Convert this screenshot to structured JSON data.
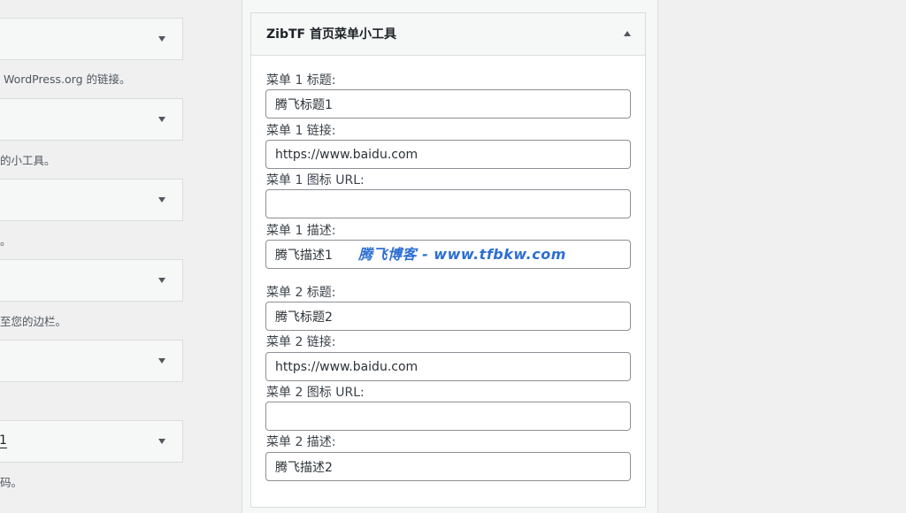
{
  "available_widgets": {
    "bars": [
      {
        "label": ""
      },
      {
        "label": ""
      },
      {
        "label": ""
      },
      {
        "label": ""
      },
      {
        "label": ""
      },
      {
        "label": "1"
      }
    ],
    "descriptions": [
      "WordPress.org 的链接。",
      "的小工具。",
      "。",
      "至您的边栏。",
      "码。"
    ]
  },
  "widget": {
    "title": "ZibTF 首页菜单小工具",
    "fields": [
      {
        "label": "菜单 1 标题:",
        "value": ""
      },
      {
        "label": "菜单 1 链接:",
        "value": "https://www.baidu.com"
      },
      {
        "label": "菜单 1 图标 URL:",
        "value": ""
      },
      {
        "label": "菜单 1 描述:",
        "value": "腾飞描述1"
      },
      {
        "label": "菜单 2 标题:",
        "value": "腾飞标题2"
      },
      {
        "label": "菜单 2 链接:",
        "value": "https://www.baidu.com"
      },
      {
        "label": "菜单 2 图标 URL:",
        "value": ""
      },
      {
        "label": "菜单 2 描述:",
        "value": "腾飞描述2"
      }
    ],
    "field0_value": "腾飞标题1"
  },
  "watermark": {
    "text": "腾飞博客 - www.tfbkw.com",
    "color": "#2d6fd1"
  },
  "colors": {
    "background": "#f0f0f1",
    "border": "#dcdcde",
    "input_border": "#8c8f94"
  }
}
